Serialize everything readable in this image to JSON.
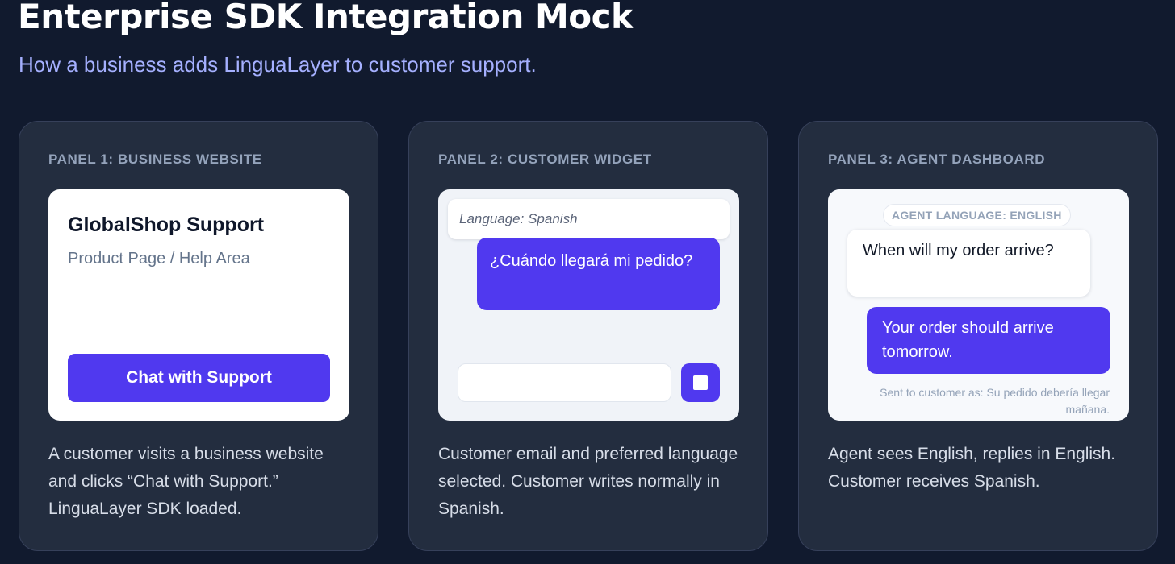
{
  "header": {
    "title": "Enterprise SDK Integration Mock",
    "subtitle": "How a business adds LinguaLayer to customer support."
  },
  "panels": [
    {
      "label": "PANEL 1: BUSINESS WEBSITE",
      "store_name": "GlobalShop Support",
      "store_sub": "Product Page / Help Area",
      "button_label": "Chat with Support",
      "description": "A customer visits a business website and clicks “Chat with Support.” LinguaLayer SDK loaded."
    },
    {
      "label": "PANEL 2: CUSTOMER WIDGET",
      "language_label": "Language: Spanish",
      "customer_message": "¿Cuándo llegará mi pedido?",
      "input_value": "",
      "input_placeholder": "",
      "description": "Customer email and preferred language selected. Customer writes normally in Spanish."
    },
    {
      "label": "PANEL 3: AGENT DASHBOARD",
      "agent_language": "AGENT LANGUAGE: ENGLISH",
      "incoming_message": "When will my order arrive?",
      "agent_reply": "Your order should arrive tomorrow.",
      "sent_note": "Sent to customer as: Su pedido debería llegar mañana.",
      "description": "Agent sees English, replies in English. Customer receives Spanish."
    }
  ],
  "colors": {
    "background": "#111a2e",
    "panel": "#232d3f",
    "accent": "#5039ef",
    "subtitle": "#a5b0ff"
  },
  "icons": {
    "send_button": "stop-icon"
  }
}
